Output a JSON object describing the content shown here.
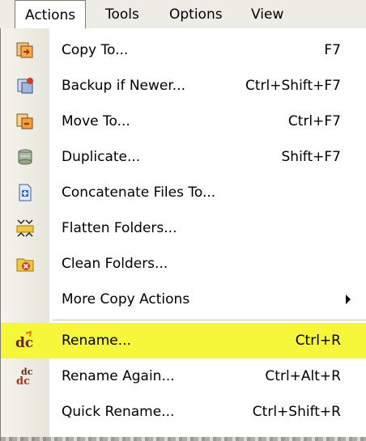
{
  "menubar": {
    "items": [
      {
        "label": "Actions",
        "active": true
      },
      {
        "label": "Tools",
        "active": false
      },
      {
        "label": "Options",
        "active": false
      },
      {
        "label": "View",
        "active": false
      }
    ]
  },
  "menu": {
    "items": [
      {
        "label": "Copy To...",
        "shortcut": "F7",
        "icon": "copy-to-icon"
      },
      {
        "label": "Backup if Newer...",
        "shortcut": "Ctrl+Shift+F7",
        "icon": "backup-icon"
      },
      {
        "label": "Move To...",
        "shortcut": "Ctrl+F7",
        "icon": "move-to-icon"
      },
      {
        "label": "Duplicate...",
        "shortcut": "Shift+F7",
        "icon": "duplicate-icon"
      },
      {
        "label": "Concatenate Files To...",
        "shortcut": "",
        "icon": "concatenate-icon"
      },
      {
        "label": "Flatten Folders...",
        "shortcut": "",
        "icon": "flatten-folders-icon"
      },
      {
        "label": "Clean Folders...",
        "shortcut": "",
        "icon": "clean-folders-icon"
      },
      {
        "label": "More Copy Actions",
        "shortcut": "",
        "icon": "",
        "submenu": true
      },
      {
        "label": "Rename...",
        "shortcut": "Ctrl+R",
        "icon": "rename-icon",
        "highlighted": true
      },
      {
        "label": "Rename Again...",
        "shortcut": "Ctrl+Alt+R",
        "icon": "rename-again-icon"
      },
      {
        "label": "Quick Rename...",
        "shortcut": "Ctrl+Shift+R",
        "icon": ""
      }
    ]
  },
  "colors": {
    "highlight": "#f6f63a",
    "menubar_bg": "#eeede5"
  }
}
